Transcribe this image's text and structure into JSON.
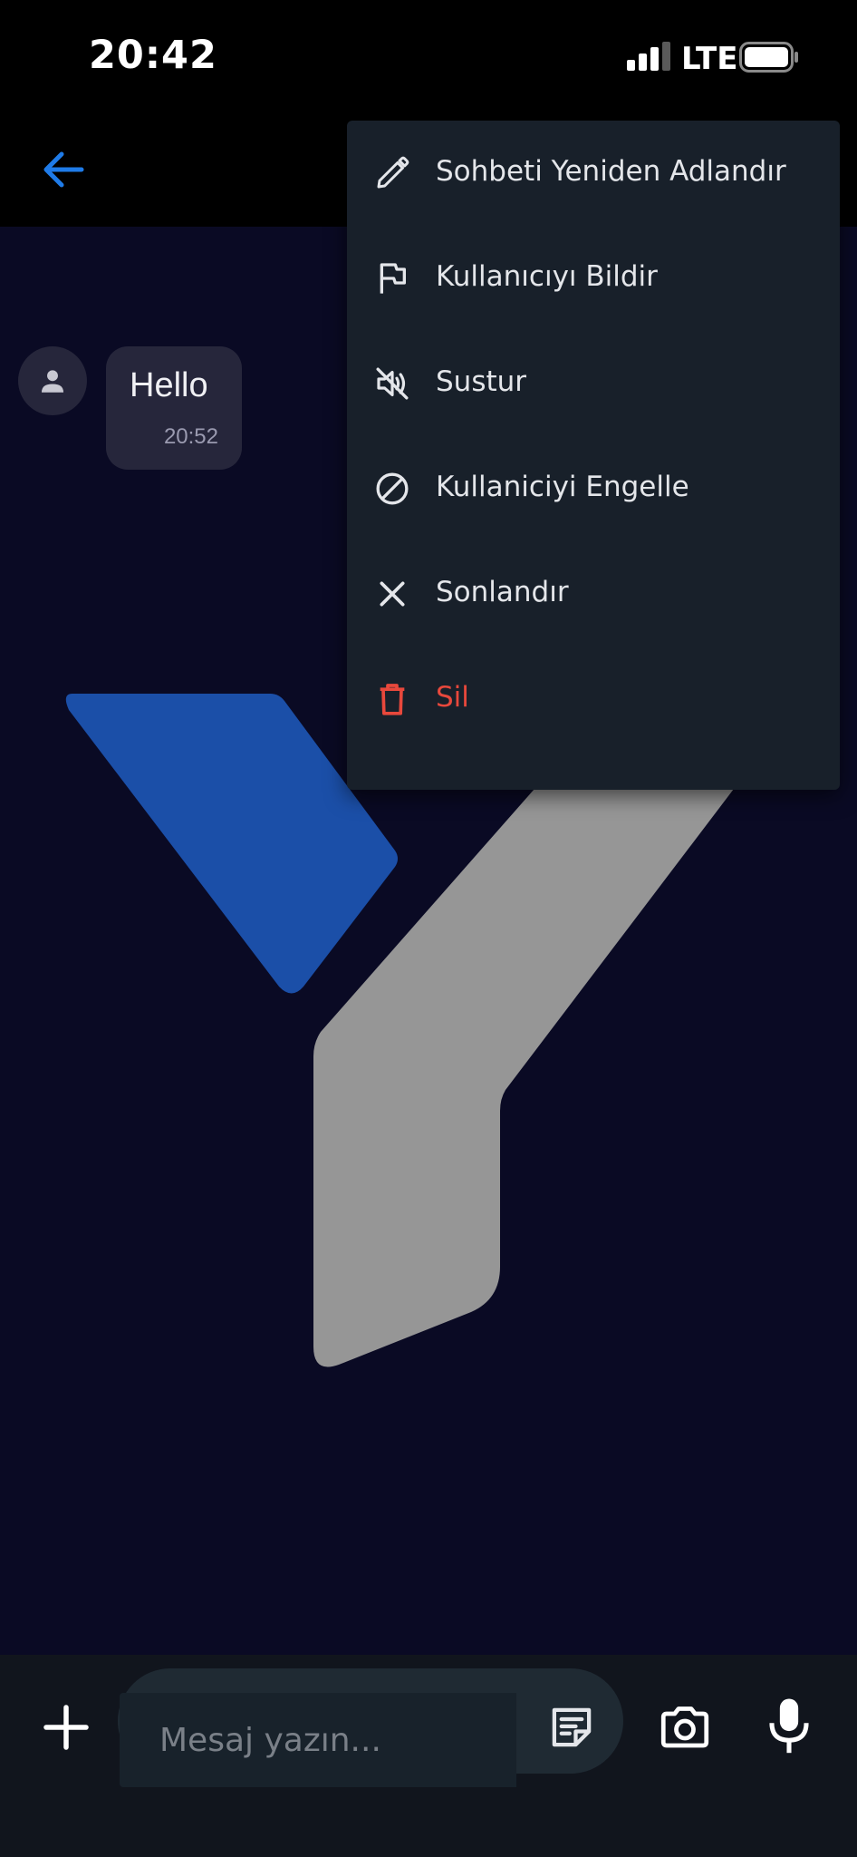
{
  "status_bar": {
    "time": "20:42",
    "network": "LTE"
  },
  "header": {
    "back_icon": "arrow-left-icon"
  },
  "colors": {
    "accent": "#1f7be8",
    "danger": "#e8483c",
    "menu_bg": "#18202a",
    "bubble_bg": "#26263b"
  },
  "messages": [
    {
      "text": "Hello",
      "time": "20:52"
    }
  ],
  "menu": {
    "items": [
      {
        "label": "Sohbeti Yeniden Adlandır",
        "icon": "pencil-icon"
      },
      {
        "label": "Kullanıcıyı Bildir",
        "icon": "flag-icon"
      },
      {
        "label": "Sustur",
        "icon": "volume-off-icon"
      },
      {
        "label": "Kullaniciyi Engelle",
        "icon": "block-icon"
      },
      {
        "label": "Sonlandır",
        "icon": "close-icon"
      },
      {
        "label": "Sil",
        "icon": "trash-icon"
      }
    ]
  },
  "composer": {
    "placeholder": "Mesaj yazın..."
  }
}
